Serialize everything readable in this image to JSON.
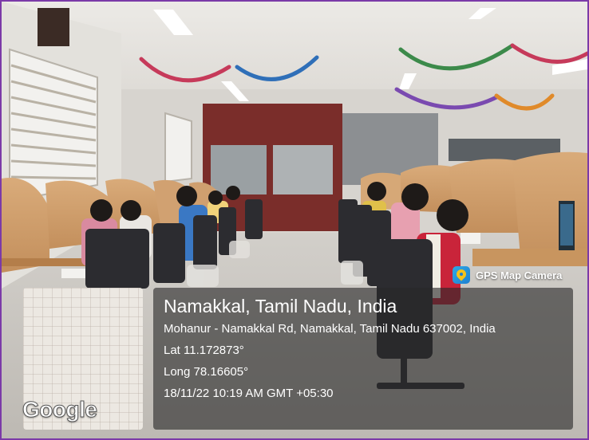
{
  "badge": {
    "label": "GPS Map Camera",
    "icon": "gps-map-camera-icon"
  },
  "location": {
    "place": "Namakkal, Tamil Nadu, India",
    "address": "Mohanur - Namakkal Rd, Namakkal, Tamil Nadu 637002, India",
    "lat": "Lat 11.172873°",
    "long": "Long 78.16605°",
    "datetime": "18/11/22 10:19 AM GMT +05:30"
  },
  "map": {
    "provider": "Google"
  },
  "colors": {
    "frame_border": "#7b3aa8"
  }
}
